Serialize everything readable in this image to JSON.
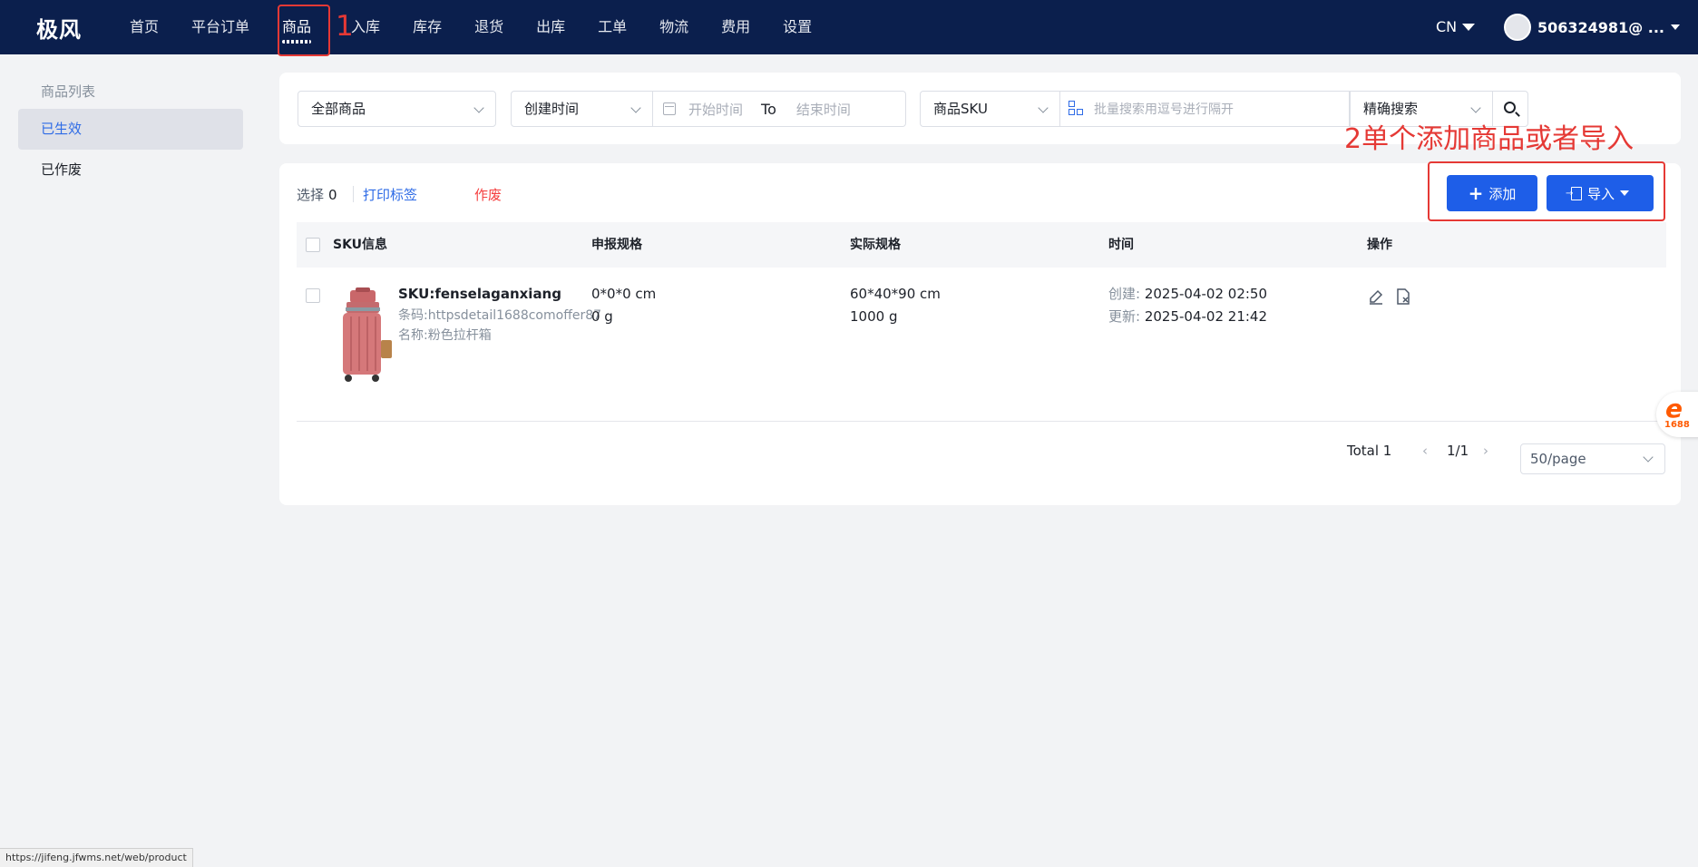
{
  "app": {
    "logo": "极风"
  },
  "nav": {
    "items": [
      {
        "label": "首页"
      },
      {
        "label": "平台订单"
      },
      {
        "label": "商品"
      },
      {
        "label": "入库"
      },
      {
        "label": "库存"
      },
      {
        "label": "退货"
      },
      {
        "label": "出库"
      },
      {
        "label": "工单"
      },
      {
        "label": "物流"
      },
      {
        "label": "费用"
      },
      {
        "label": "设置"
      }
    ],
    "active_index": 2,
    "language": "CN",
    "user": "506324981@ ..."
  },
  "sidebar": {
    "title": "商品列表",
    "items": [
      {
        "label": "已生效",
        "active": true
      },
      {
        "label": "已作废",
        "active": false
      }
    ]
  },
  "filters": {
    "category_select": "全部商品",
    "time_type_select": "创建时间",
    "start_placeholder": "开始时间",
    "to_label": "To",
    "end_placeholder": "结束时间",
    "field_select": "商品SKU",
    "bulk_placeholder": "批量搜索用逗号进行隔开",
    "mode_select": "精确搜索"
  },
  "toolbar": {
    "select_label": "选择",
    "select_count": "0",
    "print_label": "打印标签",
    "void_label": "作废",
    "add_label": "添加",
    "import_label": "导入"
  },
  "table": {
    "columns": [
      "SKU信息",
      "申报规格",
      "实际规格",
      "时间",
      "操作"
    ],
    "rows": [
      {
        "sku": "SKU:fenselaganxiang",
        "barcode": "条码:httpsdetail1688comoffer87",
        "name": "名称:粉色拉杆箱",
        "declared_size": "0*0*0 cm",
        "declared_weight": "0 g",
        "actual_size": "60*40*90 cm",
        "actual_weight": "1000 g",
        "created_label": "创建:",
        "created": "2025-04-02 02:50",
        "updated_label": "更新:",
        "updated": "2025-04-02 21:42"
      }
    ]
  },
  "pagination": {
    "total": "Total 1",
    "page": "1/1",
    "page_size": "50/page"
  },
  "annotations": {
    "step1": "1",
    "step2": "2单个添加商品或者导入",
    "color": "#e53935"
  },
  "badge": {
    "mark": "e",
    "number": "1688"
  },
  "statusbar": {
    "url": "https://jifeng.jfwms.net/web/product"
  },
  "colors": {
    "topbar": "#0b1f4d",
    "primary": "#1e5ee8",
    "danger": "#f53f3f",
    "link": "#2e6be6"
  }
}
